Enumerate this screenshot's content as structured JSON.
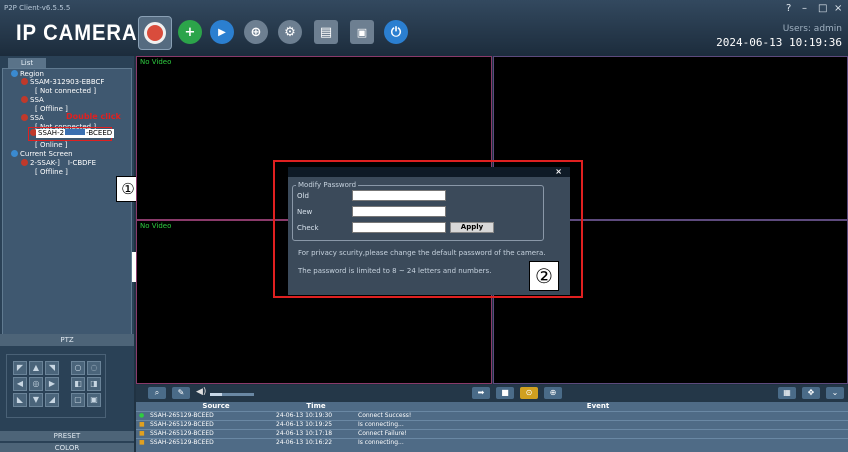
{
  "app": {
    "version": "P2P Client-v6.5.5.5",
    "logo": "IP CAMERA",
    "users": "Users: admin",
    "datetime": "2024-06-13  10:19:36"
  },
  "window_controls": [
    "?",
    "–",
    "□",
    "×"
  ],
  "toolbar": [
    {
      "icon": "camera-preview-icon",
      "glyph": "◉",
      "color": "#d94c3c"
    },
    {
      "icon": "add-device-icon",
      "glyph": "+",
      "color": "#2ca44a"
    },
    {
      "icon": "playback-icon",
      "glyph": "▶",
      "color": "#2b7fd0"
    },
    {
      "icon": "ptz-wheel-icon",
      "glyph": "⊕",
      "color": "#6d7f91"
    },
    {
      "icon": "settings-gear-icon",
      "glyph": "⚙",
      "color": "#6d7f91"
    },
    {
      "icon": "log-document-icon",
      "glyph": "▤",
      "color": "#6d7f91"
    },
    {
      "icon": "lock-icon",
      "glyph": "🔒",
      "color": "#6d7f91"
    },
    {
      "icon": "power-icon",
      "glyph": "⏻",
      "color": "#2b7fd0"
    }
  ],
  "sidebar": {
    "tab": "List",
    "tree": {
      "region": "Region",
      "dev1": "SSAM-312903-EBBCF",
      "dev1_status": "[ Not connected ]",
      "dev2": "SSA",
      "dev2_status": "[ Offline ]",
      "dev3": "SSA",
      "dev3_status": "[ Not connected ]",
      "dev4": "SSAH-2",
      "dev4_tail": "-BCEED",
      "dev4_status": "[ Online ]",
      "current_screen": "Current Screen",
      "dev5": "2-SSAK-]",
      "dev5_tail": "I-CBDFE",
      "dev5_status": "[ Offline ]"
    },
    "annotation_double_click": "Double click",
    "annotation_1": "①",
    "ptz_header": "PTZ",
    "preset_header": "PRESET",
    "color_header": "COLOR"
  },
  "video": {
    "label": "No Video"
  },
  "dialog": {
    "close": "×",
    "group_title": "Modify Password",
    "old_label": "Old",
    "new_label": "New",
    "check_label": "Check",
    "apply": "Apply",
    "note1": "For privacy scurity,please change the default password of the camera.",
    "note2": "The password is limited to 8 ~ 24 letters and numbers.",
    "annotation_2": "②"
  },
  "log": {
    "headers": [
      "Source",
      "Time",
      "Event"
    ],
    "rows": [
      [
        "SSAH-265129-BCEED",
        "24-06-13 10:19:30",
        "Connect Success!"
      ],
      [
        "SSAH-265129-BCEED",
        "24-06-13 10:19:25",
        "Is connecting..."
      ],
      [
        "SSAH-265129-BCEED",
        "24-06-13 10:17:18",
        "Connect Failure!"
      ],
      [
        "SSAH-265129-BCEED",
        "24-06-13 10:16:22",
        "Is connecting..."
      ]
    ]
  }
}
